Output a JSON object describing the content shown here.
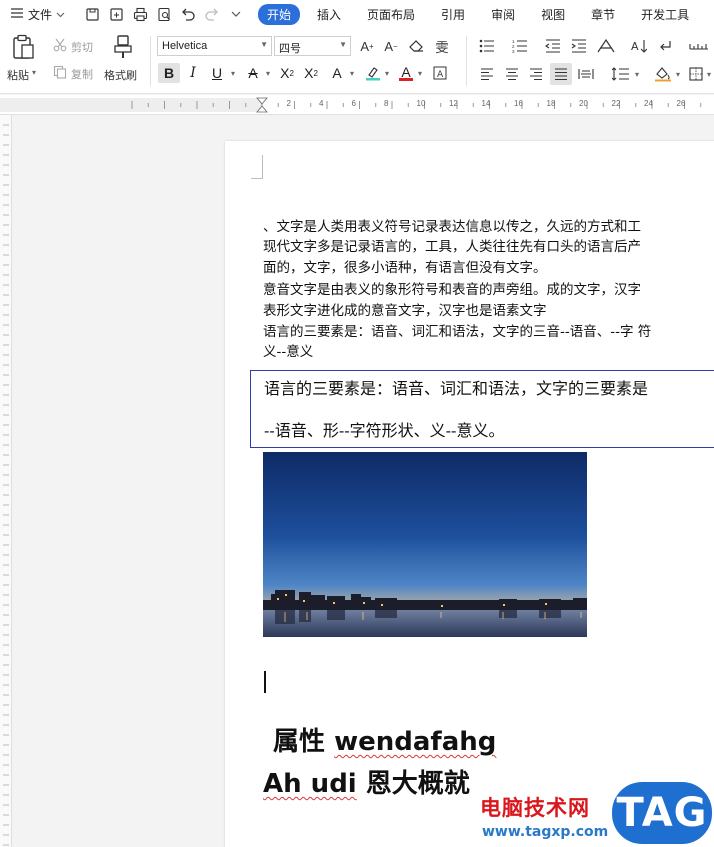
{
  "menubar": {
    "file_label": "文件",
    "tabs": [
      {
        "label": "开始",
        "active": true
      },
      {
        "label": "插入",
        "active": false
      },
      {
        "label": "页面布局",
        "active": false
      },
      {
        "label": "引用",
        "active": false
      },
      {
        "label": "审阅",
        "active": false
      },
      {
        "label": "视图",
        "active": false
      },
      {
        "label": "章节",
        "active": false
      },
      {
        "label": "开发工具",
        "active": false
      }
    ]
  },
  "ribbon": {
    "paste_label": "粘贴",
    "cut_label": "剪切",
    "copy_label": "复制",
    "format_painter_label": "格式刷",
    "font_name": "Helvetica",
    "font_size": "四号",
    "bold_label": "B",
    "italic_label": "I",
    "underline_label": "U"
  },
  "ruler": {
    "ticks": [
      "2",
      "4",
      "6",
      "8",
      "10",
      "12",
      "14",
      "16",
      "18",
      "20",
      "22",
      "24",
      "26"
    ]
  },
  "document": {
    "paragraphs": [
      "、文字是人类用表义符号记录表达信息以传之，久远的方式和工",
      "现代文字多是记录语言的，工具，人类往往先有口头的语言后产",
      "面的，文字，很多小语种，有语言但没有文字。",
      "意音文字是由表义的象形符号和表音的声旁组。成的文字，汉字",
      "表形文字进化成的意音文字，汉字也是语素文字",
      "语言的三要素是：语音、词汇和语法，文字的三音--语音、--字  符",
      "义--意义"
    ],
    "textbox_lines": [
      "语言的三要素是：语音、词汇和语法，文字的三要素是",
      "--语音、形--字符形状、义--意义。"
    ],
    "heading1_cn": "属性",
    "heading1_en": "wendafahg",
    "heading2_en": "Ah udi",
    "heading2_cn": "恩大概就"
  },
  "watermark": {
    "site_name": "电脑技术网",
    "url": "www.tagxp.com",
    "tag": "TAG"
  },
  "colors": {
    "accent": "#2b6fdb",
    "textbox_border": "#2c3fa8",
    "watermark_red": "#d9161c",
    "watermark_blue": "#1f6fd0"
  }
}
